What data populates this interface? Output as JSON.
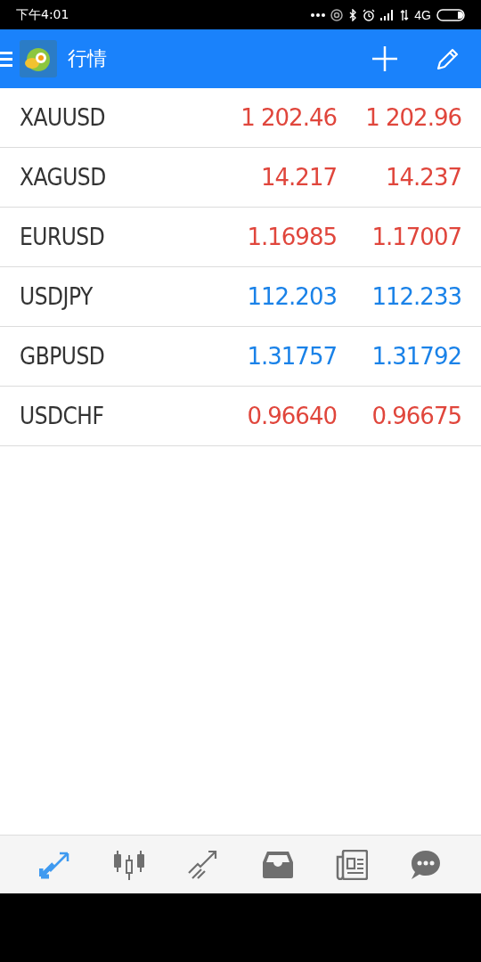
{
  "status_bar": {
    "time": "下午4:01",
    "network": "4G"
  },
  "toolbar": {
    "title": "行情"
  },
  "quotes": [
    {
      "symbol": "XAUUSD",
      "bid": "1 202.46",
      "ask": "1 202.96",
      "color": "#e0463c"
    },
    {
      "symbol": "XAGUSD",
      "bid": "14.217",
      "ask": "14.237",
      "color": "#e0463c"
    },
    {
      "symbol": "EURUSD",
      "bid": "1.16985",
      "ask": "1.17007",
      "color": "#e0463c"
    },
    {
      "symbol": "USDJPY",
      "bid": "112.203",
      "ask": "112.233",
      "color": "#1a82e8"
    },
    {
      "symbol": "GBPUSD",
      "bid": "1.31757",
      "ask": "1.31792",
      "color": "#1a82e8"
    },
    {
      "symbol": "USDCHF",
      "bid": "0.96640",
      "ask": "0.96675",
      "color": "#e0463c"
    }
  ],
  "bottom_nav": [
    {
      "kind": "quotes",
      "selected": true
    },
    {
      "kind": "chart",
      "selected": false
    },
    {
      "kind": "trade",
      "selected": false
    },
    {
      "kind": "history",
      "selected": false
    },
    {
      "kind": "news",
      "selected": false
    },
    {
      "kind": "messages",
      "selected": false
    }
  ]
}
